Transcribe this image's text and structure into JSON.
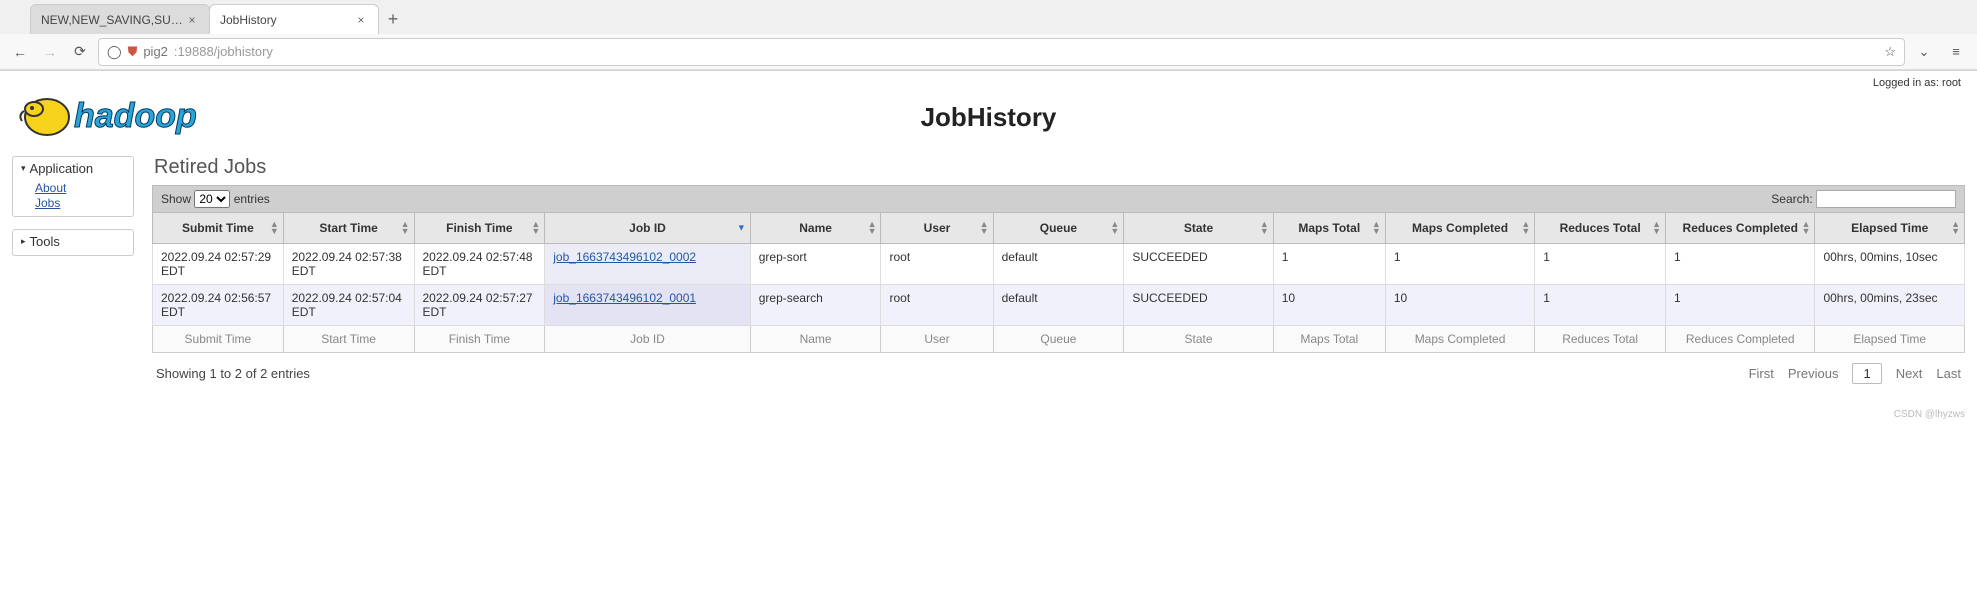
{
  "browser": {
    "tabs": [
      {
        "title": "NEW,NEW_SAVING,SUBMIT"
      },
      {
        "title": "JobHistory"
      }
    ],
    "url_shield": "⛉",
    "url_host": "pig2",
    "url_rest": ":19888/jobhistory"
  },
  "logged_in": "Logged in as: root",
  "page_title": "JobHistory",
  "sidebar": {
    "app_header": "Application",
    "app_links": [
      "About",
      "Jobs"
    ],
    "tools_header": "Tools"
  },
  "section_title": "Retired Jobs",
  "length_menu": {
    "show": "Show",
    "value": "20",
    "entries": "entries"
  },
  "search_label": "Search:",
  "columns": [
    "Submit Time",
    "Start Time",
    "Finish Time",
    "Job ID",
    "Name",
    "User",
    "Queue",
    "State",
    "Maps Total",
    "Maps Completed",
    "Reduces Total",
    "Reduces Completed",
    "Elapsed Time"
  ],
  "rows": [
    {
      "submit": "2022.09.24 02:57:29 EDT",
      "start": "2022.09.24 02:57:38 EDT",
      "finish": "2022.09.24 02:57:48 EDT",
      "jobid": "job_1663743496102_0002",
      "name": "grep-sort",
      "user": "root",
      "queue": "default",
      "state": "SUCCEEDED",
      "maps_total": "1",
      "maps_completed": "1",
      "reduces_total": "1",
      "reduces_completed": "1",
      "elapsed": "00hrs, 00mins, 10sec"
    },
    {
      "submit": "2022.09.24 02:56:57 EDT",
      "start": "2022.09.24 02:57:04 EDT",
      "finish": "2022.09.24 02:57:27 EDT",
      "jobid": "job_1663743496102_0001",
      "name": "grep-search",
      "user": "root",
      "queue": "default",
      "state": "SUCCEEDED",
      "maps_total": "10",
      "maps_completed": "10",
      "reduces_total": "1",
      "reduces_completed": "1",
      "elapsed": "00hrs, 00mins, 23sec"
    }
  ],
  "footer_cols": [
    "Submit Time",
    "Start Time",
    "Finish Time",
    "Job ID",
    "Name",
    "User",
    "Queue",
    "State",
    "Maps Total",
    "Maps Completed",
    "Reduces Total",
    "Reduces Completed",
    "Elapsed Time"
  ],
  "info_text": "Showing 1 to 2 of 2 entries",
  "pager": {
    "first": "First",
    "prev": "Previous",
    "current": "1",
    "next": "Next",
    "last": "Last"
  },
  "watermark": "CSDN @lhyzws"
}
